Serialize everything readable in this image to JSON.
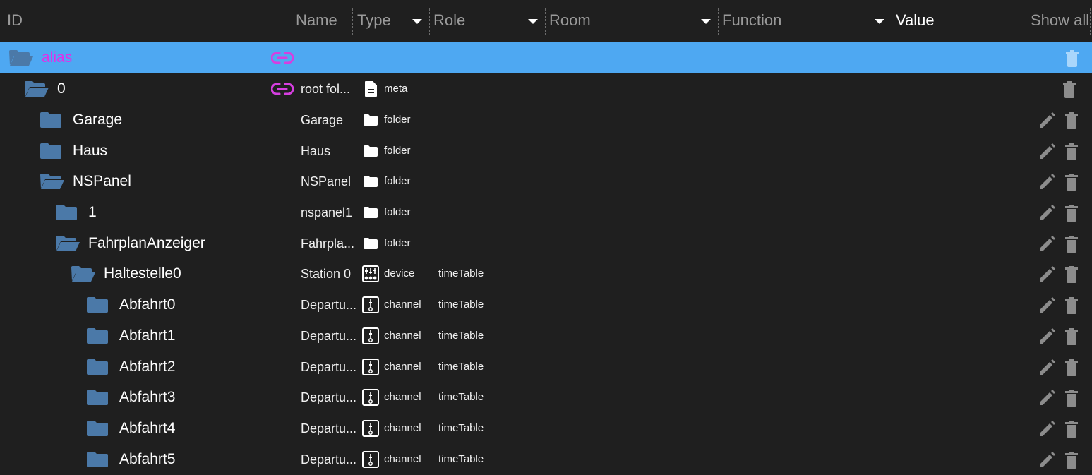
{
  "header": {
    "id_label": "ID",
    "name_label": "Name",
    "type_label": "Type",
    "role_label": "Role",
    "room_label": "Room",
    "function_label": "Function",
    "value_label": "Value",
    "show_all_label": "Show all"
  },
  "colors": {
    "background": "#1f1f1f",
    "selected_row": "#4ea8f2",
    "alias_text": "#e030e8",
    "folder_icon": "#4b79a8",
    "action_icon": "#8c8c8c"
  },
  "rows": [
    {
      "id": "alias",
      "name": "",
      "type": "",
      "role": "",
      "folder_open": true,
      "selected": true,
      "link": true,
      "type_icon": "",
      "edit": false
    },
    {
      "id": "0",
      "name": "root fol...",
      "type": "meta",
      "role": "",
      "folder_open": true,
      "selected": false,
      "link": true,
      "type_icon": "file-icon",
      "edit": false
    },
    {
      "id": "Garage",
      "name": "Garage",
      "type": "folder",
      "role": "",
      "folder_open": false,
      "selected": false,
      "link": false,
      "type_icon": "folder-icon",
      "edit": true
    },
    {
      "id": "Haus",
      "name": "Haus",
      "type": "folder",
      "role": "",
      "folder_open": false,
      "selected": false,
      "link": false,
      "type_icon": "folder-icon",
      "edit": true
    },
    {
      "id": "NSPanel",
      "name": "NSPanel",
      "type": "folder",
      "role": "",
      "folder_open": true,
      "selected": false,
      "link": false,
      "type_icon": "folder-icon",
      "edit": true
    },
    {
      "id": "1",
      "name": "nspanel1",
      "type": "folder",
      "role": "",
      "folder_open": false,
      "selected": false,
      "link": false,
      "type_icon": "folder-icon",
      "edit": true
    },
    {
      "id": "FahrplanAnzeiger",
      "name": "Fahrpla...",
      "type": "folder",
      "role": "",
      "folder_open": true,
      "selected": false,
      "link": false,
      "type_icon": "folder-icon",
      "edit": true
    },
    {
      "id": "Haltestelle0",
      "name": "Station 0",
      "type": "device",
      "role": "timeTable",
      "folder_open": true,
      "selected": false,
      "link": false,
      "type_icon": "device-icon",
      "edit": true
    },
    {
      "id": "Abfahrt0",
      "name": "Departu...",
      "type": "channel",
      "role": "timeTable",
      "folder_open": false,
      "selected": false,
      "link": false,
      "type_icon": "channel-icon",
      "edit": true
    },
    {
      "id": "Abfahrt1",
      "name": "Departu...",
      "type": "channel",
      "role": "timeTable",
      "folder_open": false,
      "selected": false,
      "link": false,
      "type_icon": "channel-icon",
      "edit": true
    },
    {
      "id": "Abfahrt2",
      "name": "Departu...",
      "type": "channel",
      "role": "timeTable",
      "folder_open": false,
      "selected": false,
      "link": false,
      "type_icon": "channel-icon",
      "edit": true
    },
    {
      "id": "Abfahrt3",
      "name": "Departu...",
      "type": "channel",
      "role": "timeTable",
      "folder_open": false,
      "selected": false,
      "link": false,
      "type_icon": "channel-icon",
      "edit": true
    },
    {
      "id": "Abfahrt4",
      "name": "Departu...",
      "type": "channel",
      "role": "timeTable",
      "folder_open": false,
      "selected": false,
      "link": false,
      "type_icon": "channel-icon",
      "edit": true
    },
    {
      "id": "Abfahrt5",
      "name": "Departu...",
      "type": "channel",
      "role": "timeTable",
      "folder_open": false,
      "selected": false,
      "link": false,
      "type_icon": "channel-icon",
      "edit": true
    }
  ]
}
